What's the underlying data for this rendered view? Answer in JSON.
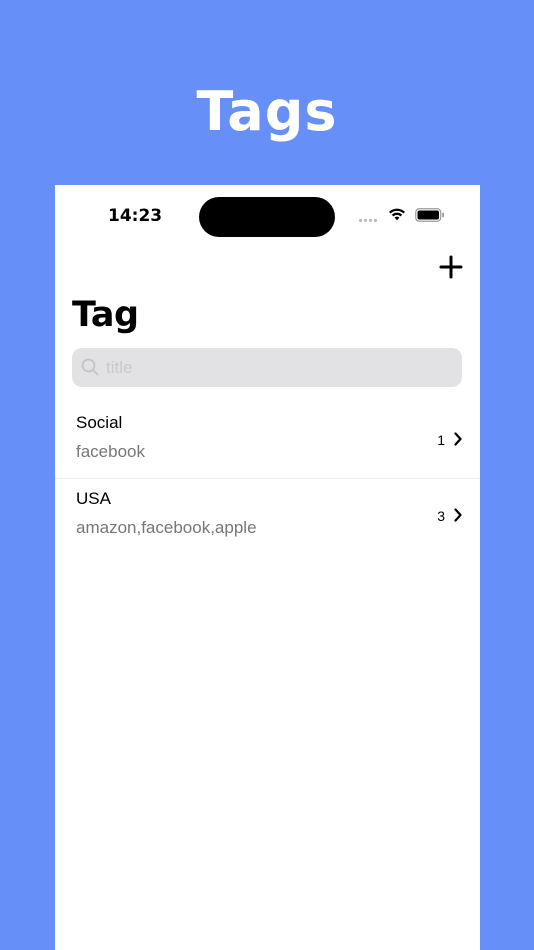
{
  "promo": {
    "title": "Tags"
  },
  "status_bar": {
    "time": "14:23"
  },
  "toolbar": {
    "add_icon": "plus-icon"
  },
  "page": {
    "title": "Tag"
  },
  "search": {
    "placeholder": "title",
    "value": "",
    "icon": "magnifier-icon"
  },
  "tags": [
    {
      "name": "Social",
      "sites": "facebook",
      "count": "1"
    },
    {
      "name": "USA",
      "sites": "amazon,facebook,apple",
      "count": "3"
    }
  ],
  "colors": {
    "background": "#6690f8",
    "screen": "#ffffff",
    "search_field": "#e2e2e5",
    "secondary_text": "#777777"
  }
}
